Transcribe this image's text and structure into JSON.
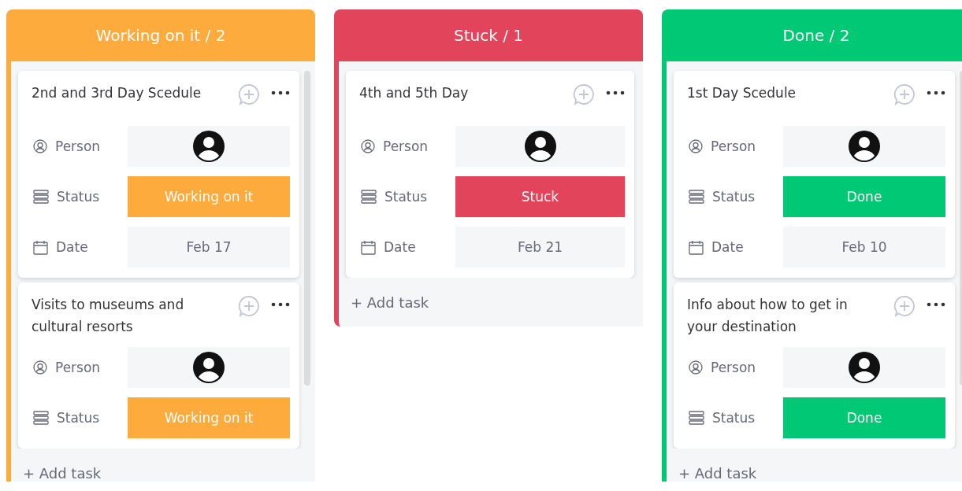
{
  "columns": [
    {
      "title": "Working on it / 2",
      "color": "#fdab3d",
      "scrollbar": true,
      "cards": [
        {
          "title": "2nd and 3rd Day Scedule",
          "fields": [
            {
              "kind": "person",
              "label": "Person"
            },
            {
              "kind": "status",
              "label": "Status",
              "value": "Working on it",
              "color": "#fdab3d"
            },
            {
              "kind": "date",
              "label": "Date",
              "value": "Feb 17"
            }
          ]
        },
        {
          "title": "Visits to museums and cultural resorts",
          "fields": [
            {
              "kind": "person",
              "label": "Person"
            },
            {
              "kind": "status",
              "label": "Status",
              "value": "Working on it",
              "color": "#fdab3d"
            }
          ]
        }
      ],
      "add_task": "+ Add task"
    },
    {
      "title": "Stuck / 1",
      "color": "#e2445c",
      "scrollbar": false,
      "cards": [
        {
          "title": "4th and 5th Day",
          "fields": [
            {
              "kind": "person",
              "label": "Person"
            },
            {
              "kind": "status",
              "label": "Status",
              "value": "Stuck",
              "color": "#e2445c"
            },
            {
              "kind": "date",
              "label": "Date",
              "value": "Feb 21"
            }
          ]
        }
      ],
      "add_task": "+ Add task"
    },
    {
      "title": "Done / 2",
      "color": "#00c875",
      "scrollbar": true,
      "cards": [
        {
          "title": "1st Day Scedule",
          "fields": [
            {
              "kind": "person",
              "label": "Person"
            },
            {
              "kind": "status",
              "label": "Status",
              "value": "Done",
              "color": "#00c875"
            },
            {
              "kind": "date",
              "label": "Date",
              "value": "Feb 10"
            }
          ]
        },
        {
          "title": "Info about how to get in your destination",
          "fields": [
            {
              "kind": "person",
              "label": "Person"
            },
            {
              "kind": "status",
              "label": "Status",
              "value": "Done",
              "color": "#00c875"
            }
          ]
        }
      ],
      "add_task": "+ Add task"
    }
  ]
}
